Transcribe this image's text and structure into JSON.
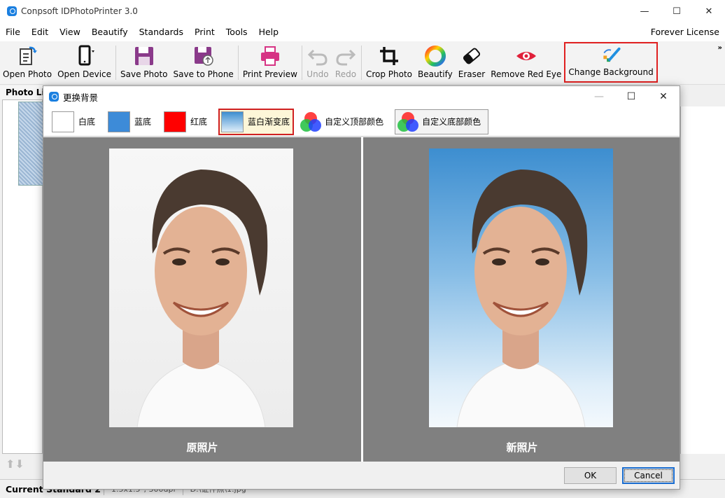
{
  "window": {
    "title": "Conpsoft IDPhotoPrinter 3.0",
    "controls": {
      "minimize": "—",
      "maximize": "☐",
      "close": "✕"
    }
  },
  "menu": {
    "items": [
      "File",
      "Edit",
      "View",
      "Beautify",
      "Standards",
      "Print",
      "Tools",
      "Help"
    ],
    "license": "Forever License"
  },
  "toolbar": {
    "open_photo": "Open Photo",
    "open_device": "Open Device",
    "save_photo": "Save Photo",
    "save_to_phone": "Save to Phone",
    "print_preview": "Print Preview",
    "undo": "Undo",
    "redo": "Redo",
    "crop_photo": "Crop Photo",
    "beautify": "Beautify",
    "eraser": "Eraser",
    "remove_red_eye": "Remove Red Eye",
    "change_background": "Change Background",
    "overflow": "»"
  },
  "photo_list": {
    "header": "Photo List"
  },
  "status": {
    "current_standard": "Current Standard 2",
    "size": "1.5x1.5\", 300dpi",
    "file": "D:\\证件照\\1.jpg"
  },
  "dialog": {
    "title": "更换背景",
    "options": {
      "white": "白底",
      "blue": "蓝底",
      "red": "红底",
      "blue_white_gradient": "蓝白渐变底",
      "custom_top": "自定义顶部颜色",
      "custom_bottom": "自定义底部颜色"
    },
    "selected_option": "蓝白渐变底",
    "original_caption": "原照片",
    "new_caption": "新照片",
    "ok": "OK",
    "cancel": "Cancel"
  },
  "colors": {
    "white": "#ffffff",
    "blue": "#3d8bd8",
    "red": "#ff0000",
    "gradient_top": "#3d8ed0",
    "gradient_bottom": "#f4f9fd",
    "highlight_border": "#e02020",
    "preview_bg": "#808080"
  }
}
